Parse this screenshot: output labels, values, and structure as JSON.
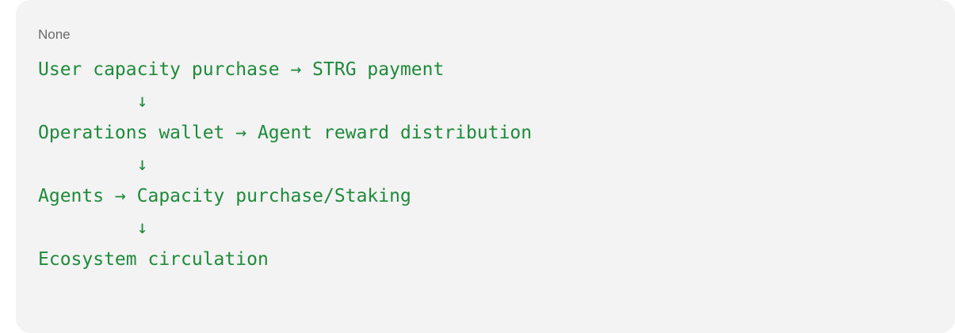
{
  "code_block": {
    "language_label": "None",
    "lines": [
      "User capacity purchase → STRG payment",
      "         ↓",
      "Operations wallet → Agent reward distribution",
      "         ↓",
      "Agents → Capacity purchase/Staking",
      "         ↓",
      "Ecosystem circulation"
    ]
  },
  "colors": {
    "code_text": "#1f8a3a",
    "label_text": "#6a6a6a",
    "card_background": "#f3f3f4"
  }
}
